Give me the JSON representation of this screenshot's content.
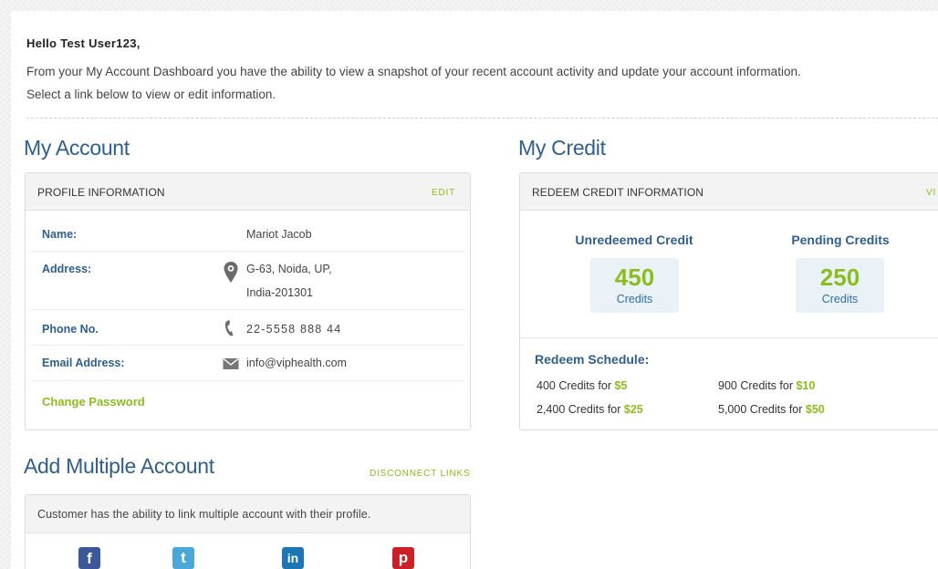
{
  "greeting": "Hello Test User123,",
  "intro": {
    "line1": "From your My Account Dashboard you have the ability to view a snapshot of your recent account activity and update your account information.",
    "line2": "Select a link below to view or edit information."
  },
  "my_account": {
    "title": "My Account",
    "panel_title": "PROFILE INFORMATION",
    "edit_label": "EDIT",
    "rows": [
      {
        "label": "Name:",
        "value": "Mariot Jacob"
      },
      {
        "label": "Address:",
        "value_line1": "G-63, Noida, UP,",
        "value_line2": "India-201301",
        "icon": "map-pin-icon"
      },
      {
        "label": "Phone No.",
        "value": "22-5558 888 44",
        "icon": "phone-icon"
      },
      {
        "label": "Email Address:",
        "value": "info@viphealth.com",
        "icon": "envelope-icon"
      }
    ],
    "change_password": "Change Password"
  },
  "my_credit": {
    "title": "My Credit",
    "panel_title": "REDEEM CREDIT INFORMATION",
    "view_label": "VI",
    "unredeemed": {
      "heading": "Unredeemed Credit",
      "value": "450",
      "unit": "Credits"
    },
    "pending": {
      "heading": "Pending Credits",
      "value": "250",
      "unit": "Credits"
    },
    "schedule_title": "Redeem Schedule:",
    "schedule": [
      {
        "credits": "400 Credits for",
        "amount": "$5"
      },
      {
        "credits": "900 Credits for",
        "amount": "$10"
      },
      {
        "credits": "2,400 Credits for",
        "amount": "$25"
      },
      {
        "credits": "5,000 Credits for",
        "amount": "$50"
      }
    ]
  },
  "multi_account": {
    "title": "Add Multiple Account",
    "disconnect_label": "DISCONNECT LINKS",
    "description": "Customer has the ability to link multiple account with their profile.",
    "socials": [
      {
        "icon": "facebook-icon",
        "glyph": "f",
        "color": "#3b5998"
      },
      {
        "icon": "twitter-icon",
        "glyph": "t",
        "color": "#4ba7d8"
      },
      {
        "icon": "linkedin-icon",
        "glyph": "in",
        "color": "#1b76b5"
      },
      {
        "icon": "pinterest-icon",
        "glyph": "p",
        "color": "#cb2027"
      }
    ]
  }
}
